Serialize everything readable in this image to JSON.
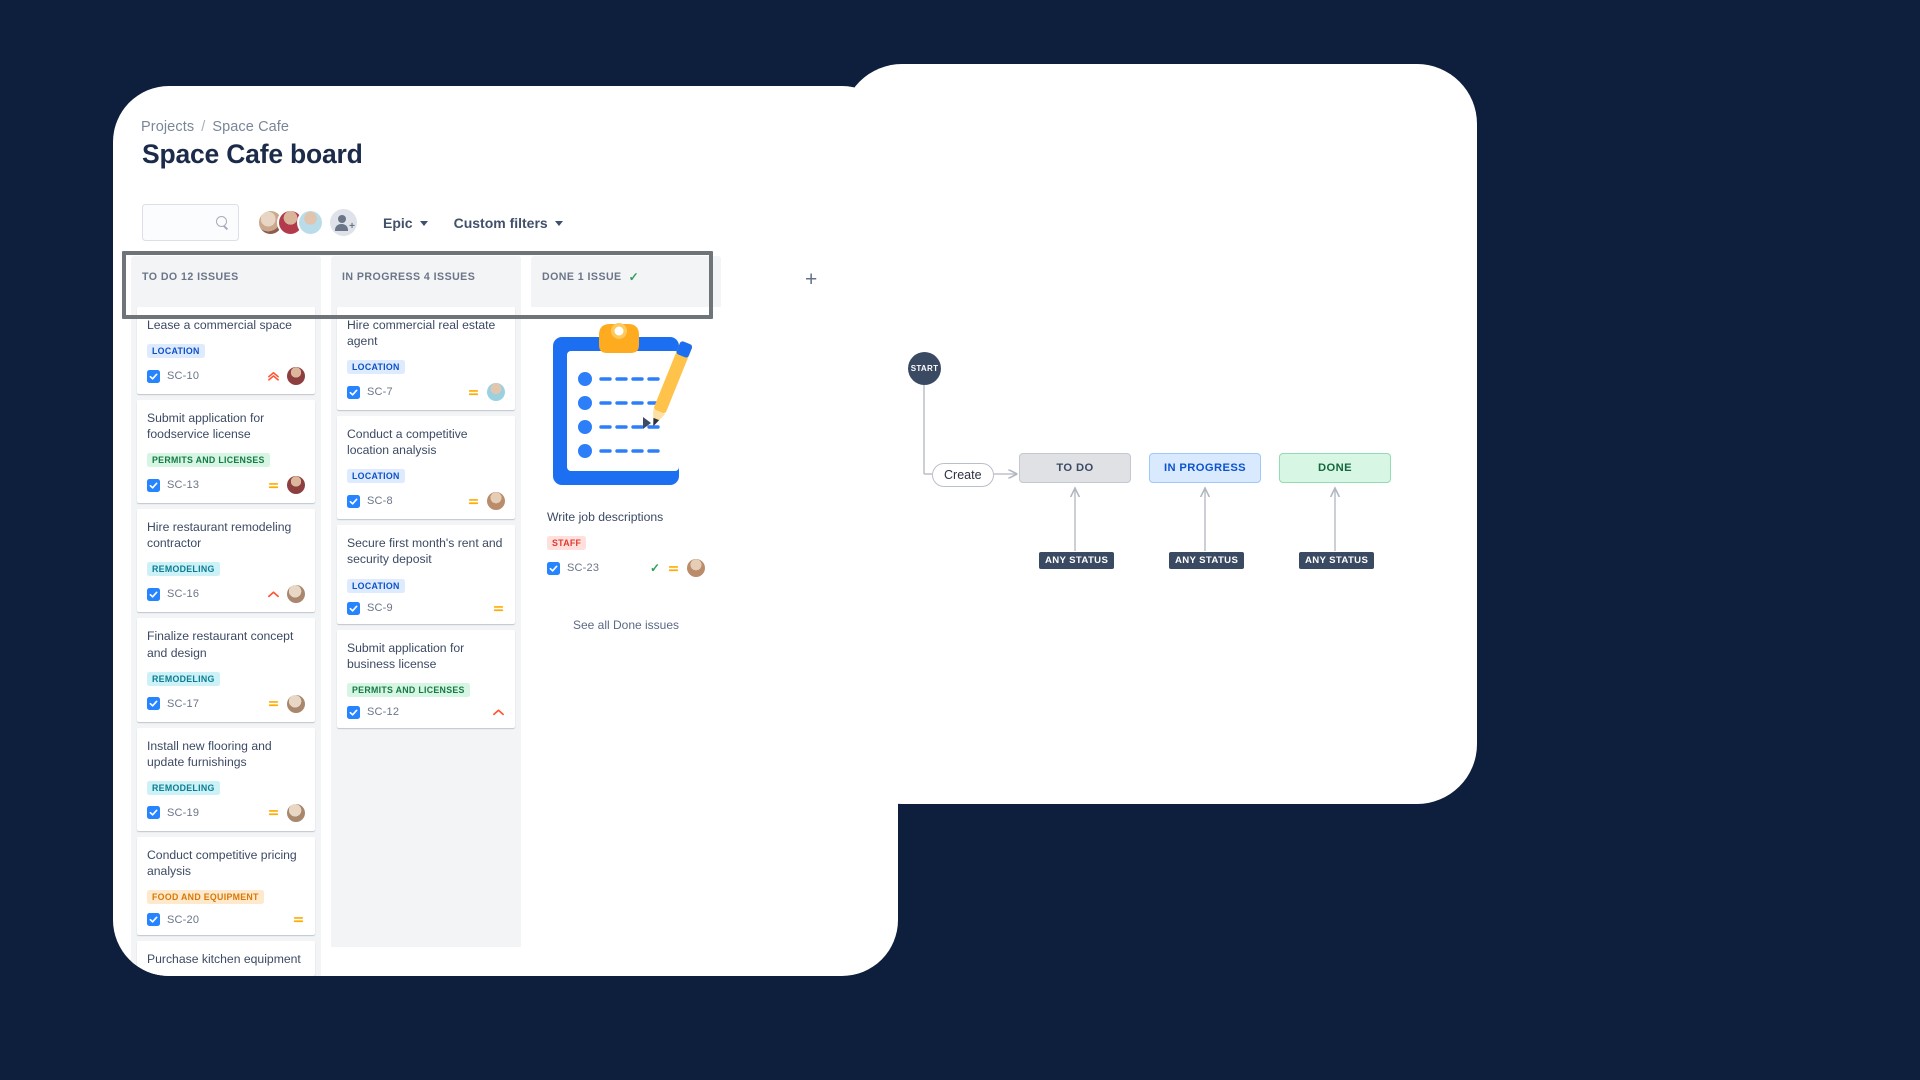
{
  "board": {
    "breadcrumb": {
      "projects": "Projects",
      "separator": "/",
      "project": "Space Cafe"
    },
    "title": "Space Cafe board",
    "toolbar": {
      "search_placeholder": "",
      "search_value": "",
      "search_icon": "search-icon",
      "add_people_icon": "add-person-icon",
      "epic_filter": "Epic",
      "custom_filters": "Custom filters"
    },
    "add_column_label": "+",
    "columns": [
      {
        "id": "todo",
        "header": "TO DO 12 ISSUES",
        "name": "TO DO",
        "count": "12 ISSUES",
        "has_done_check": false,
        "cards": [
          {
            "title": "Lease a commercial space",
            "epic": "LOCATION",
            "epic_style": "tag-location",
            "key": "SC-10",
            "priority": "highest",
            "avatar": "ca1"
          },
          {
            "title": "Submit application for foodservice license",
            "epic": "PERMITS AND LICENSES",
            "epic_style": "tag-permits",
            "key": "SC-13",
            "priority": "medium",
            "avatar": "ca1"
          },
          {
            "title": "Hire restaurant remodeling contractor",
            "epic": "REMODELING",
            "epic_style": "tag-remodel",
            "key": "SC-16",
            "priority": "high",
            "avatar": "ca3"
          },
          {
            "title": "Finalize restaurant concept and design",
            "epic": "REMODELING",
            "epic_style": "tag-remodel",
            "key": "SC-17",
            "priority": "medium",
            "avatar": "ca3"
          },
          {
            "title": "Install new flooring and update furnishings",
            "epic": "REMODELING",
            "epic_style": "tag-remodel",
            "key": "SC-19",
            "priority": "medium",
            "avatar": "ca3"
          },
          {
            "title": "Conduct competitive pricing analysis",
            "epic": "FOOD AND EQUIPMENT",
            "epic_style": "tag-food",
            "key": "SC-20",
            "priority": "medium",
            "avatar": ""
          },
          {
            "title": "Purchase kitchen equipment",
            "epic": "",
            "epic_style": "",
            "key": "",
            "priority": "",
            "avatar": ""
          }
        ]
      },
      {
        "id": "inprogress",
        "header": "IN PROGRESS 4 ISSUES",
        "name": "IN PROGRESS",
        "count": "4 ISSUES",
        "has_done_check": false,
        "cards": [
          {
            "title": "Hire commercial real estate agent",
            "epic": "LOCATION",
            "epic_style": "tag-location",
            "key": "SC-7",
            "priority": "medium",
            "avatar": "ca2"
          },
          {
            "title": "Conduct a competitive location analysis",
            "epic": "LOCATION",
            "epic_style": "tag-location",
            "key": "SC-8",
            "priority": "medium",
            "avatar": "ca4"
          },
          {
            "title": "Secure first month's rent and security deposit",
            "epic": "LOCATION",
            "epic_style": "tag-location",
            "key": "SC-9",
            "priority": "medium",
            "avatar": ""
          },
          {
            "title": "Submit application for business license",
            "epic": "PERMITS AND LICENSES",
            "epic_style": "tag-permits",
            "key": "SC-12",
            "priority": "high",
            "avatar": ""
          }
        ]
      },
      {
        "id": "done",
        "header": "DONE 1 ISSUE",
        "name": "DONE",
        "count": "1 ISSUE",
        "has_done_check": true,
        "done_check_glyph": "✓",
        "illustration": "clipboard-checklist-illustration",
        "cards": [
          {
            "title": "Write job descriptions",
            "epic": "STAFF",
            "epic_style": "tag-staff",
            "key": "SC-23",
            "priority": "medium",
            "avatar": "ca4",
            "done_check": "✓"
          }
        ],
        "see_all_label": "See all Done issues"
      }
    ]
  },
  "workflow": {
    "start_label": "START",
    "create_label": "Create",
    "statuses": [
      {
        "label": "TO DO",
        "style": "sb-todo",
        "color": "#dfe1e5"
      },
      {
        "label": "IN PROGRESS",
        "style": "sb-prog",
        "color": "#d9eaff"
      },
      {
        "label": "DONE",
        "style": "sb-done",
        "color": "#d8f6e4"
      }
    ],
    "any_status_label": "ANY STATUS",
    "any_status_labels": [
      "ANY STATUS",
      "ANY STATUS",
      "ANY STATUS"
    ]
  },
  "colors": {
    "background": "#0d1f3c",
    "panel": "#ffffff",
    "accent_blue": "#2684ff",
    "selection_border": "#6f7478"
  }
}
